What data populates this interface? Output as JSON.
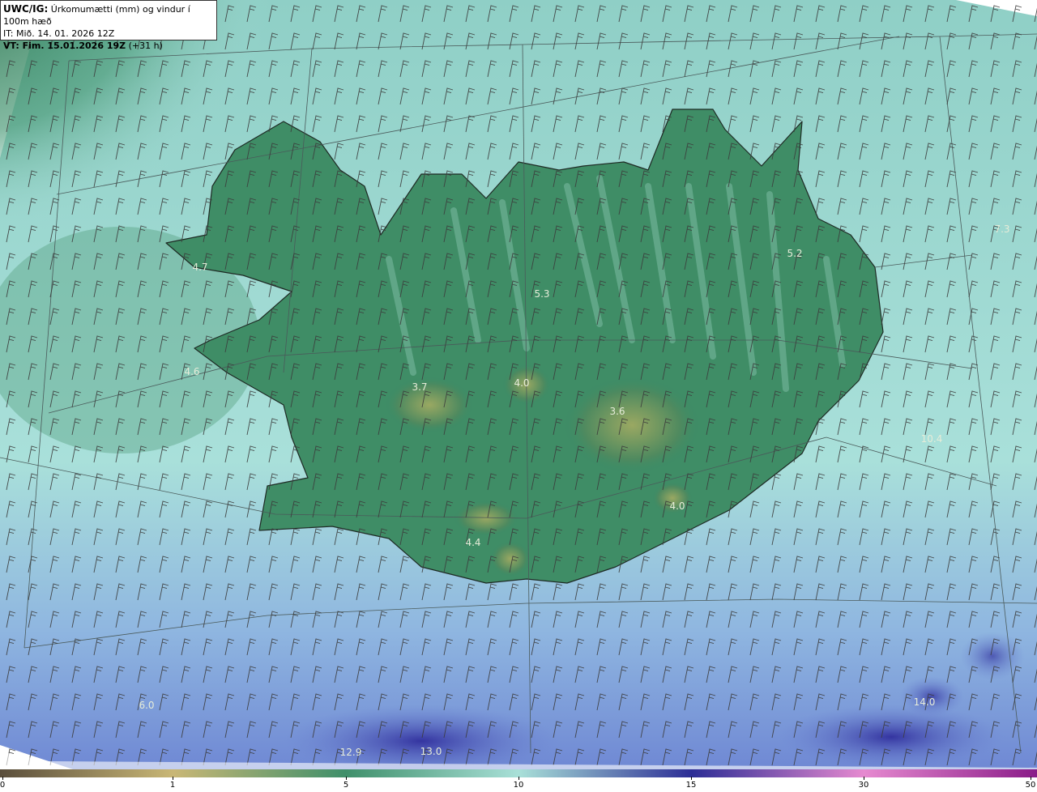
{
  "header": {
    "model_code": "UWC/IG:",
    "title": " Úrkomumætti (mm) og vindur í 100m hæð",
    "initial_time": "IT: Mið. 14. 01. 2026 12Z",
    "valid_time_label": "VT: Fim. 15.01.2026 19Z",
    "lead": " (+31 h)"
  },
  "values": [
    {
      "id": "v1",
      "text": "4.7"
    },
    {
      "id": "v2",
      "text": "4.6"
    },
    {
      "id": "v3",
      "text": "3.7"
    },
    {
      "id": "v4",
      "text": "4.0"
    },
    {
      "id": "v5",
      "text": "5.3"
    },
    {
      "id": "v6",
      "text": "3.6"
    },
    {
      "id": "v7",
      "text": "5.2"
    },
    {
      "id": "v8",
      "text": "7.3"
    },
    {
      "id": "v9",
      "text": "10.4"
    },
    {
      "id": "v10",
      "text": "4.0"
    },
    {
      "id": "v11",
      "text": "4.4"
    },
    {
      "id": "v12",
      "text": "6.0"
    },
    {
      "id": "v13",
      "text": "12.9"
    },
    {
      "id": "v14",
      "text": "13.0"
    },
    {
      "id": "v15",
      "text": "14.0"
    }
  ],
  "colorbar": {
    "ticks": [
      "0",
      "1",
      "5",
      "10",
      "15",
      "30",
      "50"
    ],
    "colors": [
      "#5a4e3c",
      "#c9b776",
      "#3f8f6a",
      "#a9e0d8",
      "#2c2d95",
      "#e68ad0",
      "#8a1c88"
    ]
  },
  "palette": {
    "land_dark": "#2f7a55",
    "land_mid": "#4d9a74",
    "sea_light": "#a6dcd4",
    "sea_blue": "#7aa4d8",
    "deep_blue": "#3a3aa8",
    "ice_cap": "#8a9a58"
  }
}
